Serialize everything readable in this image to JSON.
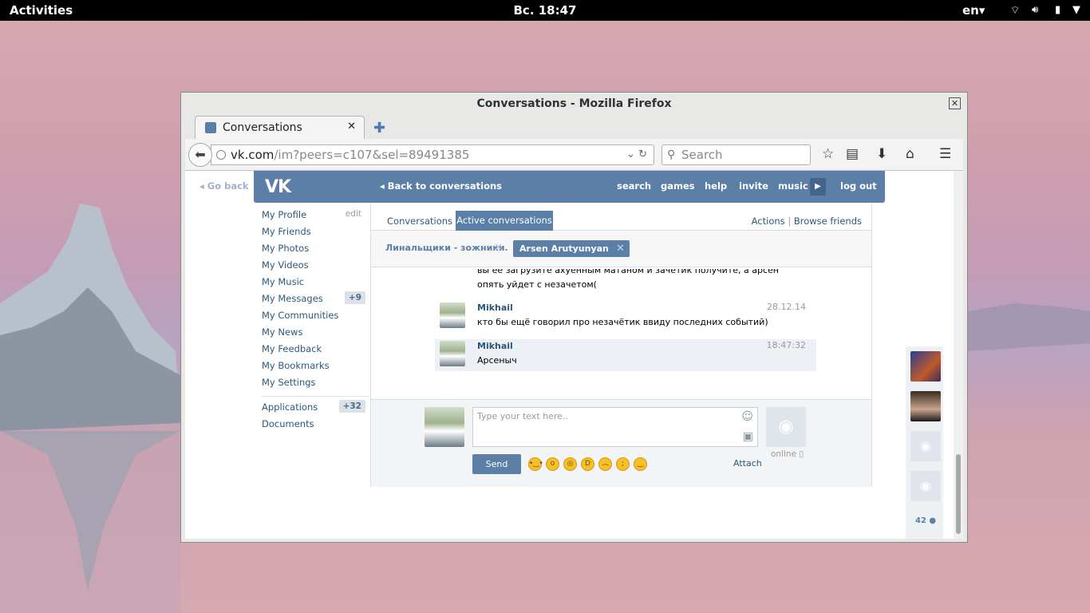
{
  "topbar": {
    "activities": "Activities",
    "clock": "Вс. 18:47",
    "lang": "en",
    "icons": [
      "wifi-icon",
      "volume-icon",
      "battery-icon",
      "menu-arrow-icon"
    ]
  },
  "window": {
    "title": "Conversations - Mozilla Firefox",
    "close": "✕",
    "tab_title": "Conversations",
    "tab_close": "✕",
    "new_tab": "✚",
    "url_host": "vk.com",
    "url_path": "/im?peers=c107&sel=89491385",
    "search_placeholder": "Search"
  },
  "vk": {
    "logo": "VK",
    "go_back": "Go back",
    "back_to_conversations": "Back to conversations",
    "nav": [
      "search",
      "games",
      "help",
      "invite",
      "music"
    ],
    "logout": "log out",
    "menu": [
      {
        "label": "My Profile",
        "extra": "edit"
      },
      {
        "label": "My Friends"
      },
      {
        "label": "My Photos"
      },
      {
        "label": "My Videos"
      },
      {
        "label": "My Music"
      },
      {
        "label": "My Messages",
        "badge": "+9"
      },
      {
        "label": "My Communities"
      },
      {
        "label": "My News"
      },
      {
        "label": "My Feedback"
      },
      {
        "label": "My Bookmarks"
      },
      {
        "label": "My Settings"
      }
    ],
    "menu2": [
      {
        "label": "Applications",
        "badge": "+32"
      },
      {
        "label": "Documents"
      }
    ],
    "tabs": {
      "conversations": "Conversations",
      "active": "Active conversations",
      "actions": "Actions",
      "sep": "|",
      "browse": "Browse friends"
    },
    "chips": {
      "first": "Линальщики - зожники.",
      "second": "Arsen Arutyunyan"
    },
    "messages": {
      "prev_line1": "вы её загрузите ахуенным матаном и зачетик получите, а арсен",
      "prev_line2": "опять уйдет с незачетом(",
      "m1_name": "Mikhail",
      "m1_date": "28.12.14",
      "m1_text": "кто бы ещё говорил про незачётик ввиду последних событий)",
      "m2_name": "Mikhail",
      "m2_date": "18:47:32",
      "m2_text": "Арсеныч"
    },
    "composer": {
      "placeholder": "Type your text here..",
      "send": "Send",
      "attach": "Attach",
      "online": "online"
    },
    "sidebar_count": "42"
  },
  "colors": {
    "vk_blue": "#5b7fa6",
    "link": "#2b587a"
  }
}
